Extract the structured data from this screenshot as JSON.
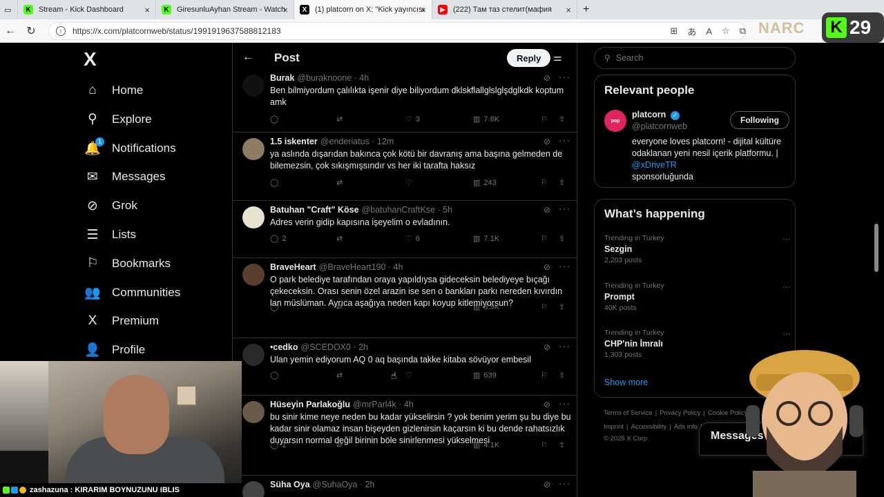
{
  "browser": {
    "tabs": [
      {
        "title": "Stream - Kick Dashboard",
        "fav_color": "#53fc18",
        "fav_glyph": "K",
        "active": false
      },
      {
        "title": "GiresunluAyhan Stream - Watch L",
        "fav_color": "#53fc18",
        "fav_glyph": "K",
        "active": false
      },
      {
        "title": "(1) platcorn on X: \"Kick yayıncısı S",
        "fav_color": "#000000",
        "fav_glyph": "X",
        "active": true
      },
      {
        "title": "(222) Там таз стелит(мафия",
        "fav_color": "#ff0000",
        "fav_glyph": "▶",
        "active": false
      }
    ],
    "new_tab": "+",
    "url": "https://x.com/platcornweb/status/1991919637588812183"
  },
  "nav": {
    "logo": "X",
    "items": [
      {
        "label": "Home",
        "icon": "home-icon",
        "glyph": "⌂"
      },
      {
        "label": "Explore",
        "icon": "search-icon",
        "glyph": "⚲"
      },
      {
        "label": "Notifications",
        "icon": "bell-icon",
        "glyph": "🔔",
        "badge": "1"
      },
      {
        "label": "Messages",
        "icon": "mail-icon",
        "glyph": "✉"
      },
      {
        "label": "Grok",
        "icon": "grok-icon",
        "glyph": "⊘"
      },
      {
        "label": "Lists",
        "icon": "list-icon",
        "glyph": "☰"
      },
      {
        "label": "Bookmarks",
        "icon": "bookmark-icon",
        "glyph": "⚐"
      },
      {
        "label": "Communities",
        "icon": "people-icon",
        "glyph": "👥"
      },
      {
        "label": "Premium",
        "icon": "x-icon",
        "glyph": "X"
      },
      {
        "label": "Profile",
        "icon": "person-icon",
        "glyph": "👤"
      }
    ]
  },
  "main": {
    "title": "Post",
    "reply_label": "Reply",
    "tweets": [
      {
        "name": "Burak",
        "handle": "@buraknoone",
        "time": "4h",
        "text": "Ben bilmiyordum çalılıkta işenir diye biliyordum dklskflallglslglşdglkdk koptum amk",
        "replies": "",
        "reposts": "",
        "likes": "3",
        "views": "7.8K",
        "avatar_color": "#111111"
      },
      {
        "name": "1.5 iskenter",
        "handle": "@enderiatus",
        "time": "12m",
        "text": "ya aslında dışarıdan bakınca çok kötü bir davranış ama başına gelmeden de bilemezsin, çok sıkışmışsındır vs her iki tarafta haksız",
        "replies": "",
        "reposts": "",
        "likes": "",
        "views": "243",
        "avatar_color": "#8d7b62"
      },
      {
        "name": "Batuhan \"Craft\" Köse",
        "handle": "@batuhanCraftKse",
        "time": "5h",
        "text": "Adres verin gidip kapısına işeyelim o evladının.",
        "replies": "2",
        "reposts": "",
        "likes": "6",
        "views": "7.1K",
        "avatar_color": "#e8e2d0"
      },
      {
        "name": "BraveHeart",
        "handle": "@BraveHeart190",
        "time": "4h",
        "text": "O park belediye tarafından oraya yapıldıysa gideceksin belediyeye bıçağı çekeceksin. Orası senin özel arazin ise sen o bankları parkı nereden kıvırdın lan müslüman. Ayrıca aşağıya neden kapı koyup kitlemiyorsun?",
        "replies": "",
        "reposts": "",
        "likes": "",
        "views": "6.9K",
        "avatar_color": "#5a3e2e"
      },
      {
        "name": "•cedko",
        "handle": "@SCEDOX0",
        "time": "2h",
        "text": "Ulan yemin ediyorum AQ 0 aq başında takke kitaba sövüyor embesil",
        "replies": "",
        "reposts": "",
        "likes": "",
        "views": "639",
        "avatar_color": "#2a2a2a"
      },
      {
        "name": "Hüseyin Parlakoğlu",
        "handle": "@mrParl4k",
        "time": "4h",
        "text": "bu sinir kime neye neden bu kadar yükselirsin ? yok benim yerim şu bu diye bu kadar sinir olamaz insan bişeyden gizlenirsin kaçarsın ki bu dende rahatsızlık duyarsın normal değil birinin böle sinirlenmesi yükselmesi",
        "replies": "1",
        "reposts": "",
        "likes": "",
        "views": "4.1K",
        "avatar_color": "#6a5a4a"
      },
      {
        "name": "Süha Oya",
        "handle": "@SuhaOya",
        "time": "2h",
        "text": "",
        "replies": "",
        "reposts": "",
        "likes": "",
        "views": "",
        "avatar_color": "#444444"
      }
    ]
  },
  "right": {
    "search_placeholder": "Search",
    "relevant_title": "Relevant people",
    "person": {
      "name": "platcorn",
      "handle": "@platcornweb",
      "follow_label": "Following",
      "bio": "everyone loves platcorn! - dijital kültüre odaklanan yeni nesil içerik platformu. |",
      "bio_link": "@xDriveTR",
      "bio_end": "sponsorluğunda"
    },
    "happening_title": "What’s happening",
    "trends": [
      {
        "category": "Trending in Turkey",
        "title": "Sezgin",
        "count": "2,203 posts"
      },
      {
        "category": "Trending in Turkey",
        "title": "Prompt",
        "count": "40K posts"
      },
      {
        "category": "Trending in Turkey",
        "title": "CHP'nin İmralı",
        "count": "1,303 posts"
      }
    ],
    "show_more": "Show more",
    "footer_row1": [
      "Terms of Service",
      "|",
      "Privacy Policy",
      "|",
      "Cookie Policy"
    ],
    "footer_row2": [
      "Imprint",
      "|",
      "Accessibility",
      "|",
      "Ads info",
      "|",
      "More ···"
    ],
    "copyright": "© 2025 X Corp.",
    "messages_label": "Messages"
  },
  "overlay": {
    "chat_user": "zashazuna",
    "chat_text": ": KIRARIM BOYNUZUNU IBLIS",
    "kick_count": "29",
    "kick_glyph": "K",
    "narc_text": "NARC"
  },
  "colors": {
    "accent": "#1d9bf0",
    "kick_green": "#53fc18",
    "muted": "#71767b",
    "border": "#2f3336"
  }
}
